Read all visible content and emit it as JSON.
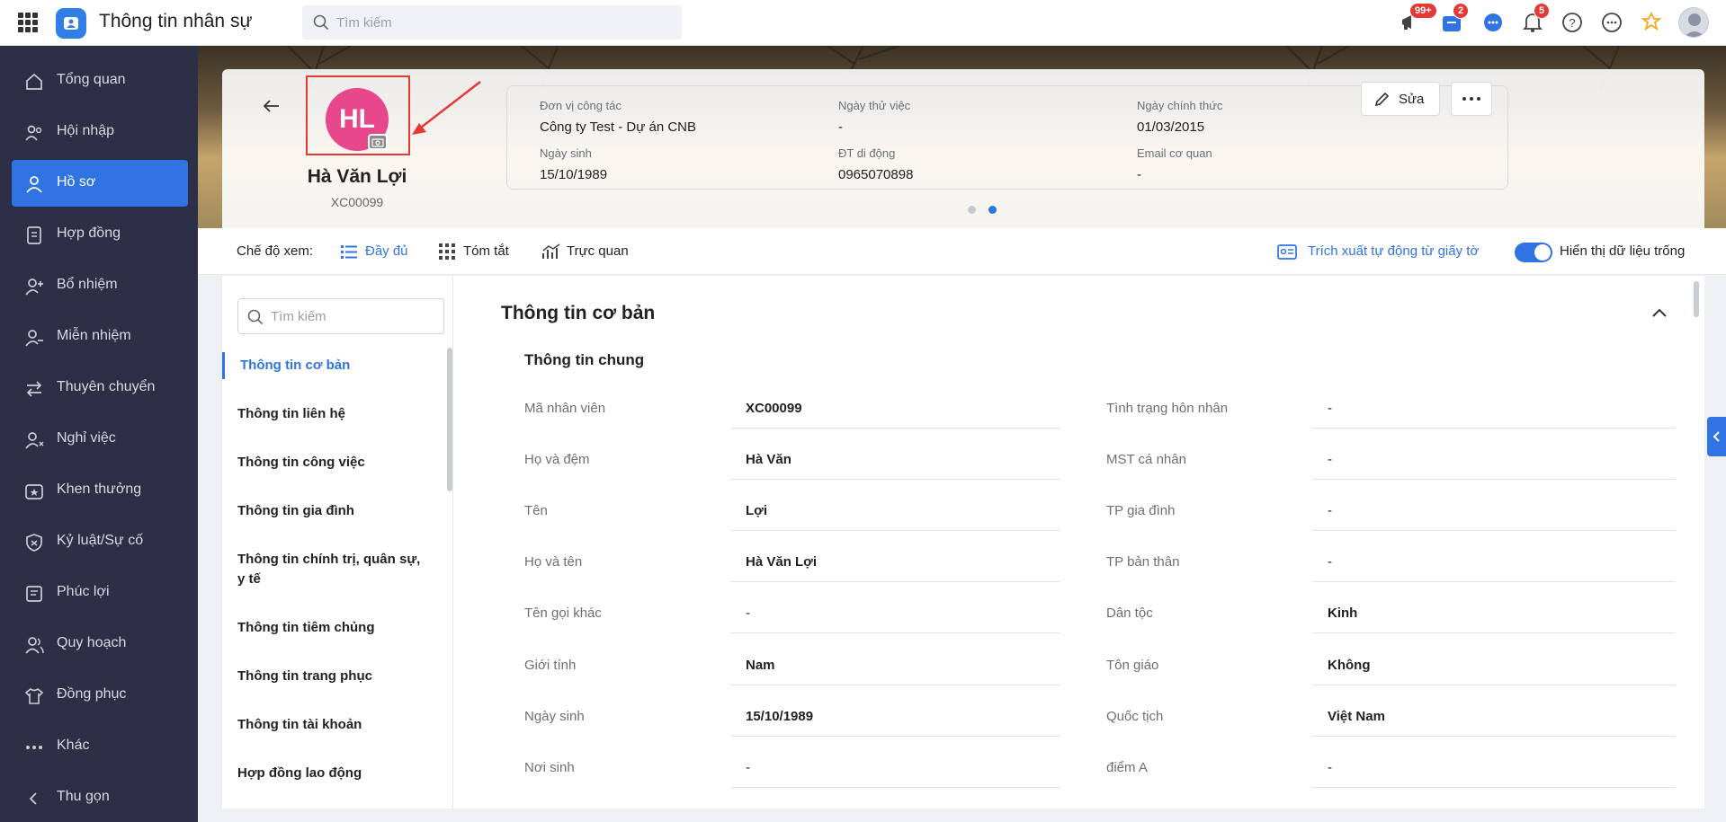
{
  "app": {
    "title": "Thông tin nhân sự",
    "search_placeholder": "Tìm kiếm"
  },
  "header_badges": {
    "announce": "99+",
    "store": "2",
    "bell": "5"
  },
  "sidebar": {
    "items": [
      {
        "label": "Tổng quan",
        "icon": "home-icon"
      },
      {
        "label": "Hội nhập",
        "icon": "users-icon"
      },
      {
        "label": "Hồ sơ",
        "icon": "user-icon",
        "active": true
      },
      {
        "label": "Hợp đồng",
        "icon": "document-icon"
      },
      {
        "label": "Bổ nhiệm",
        "icon": "user-plus-icon"
      },
      {
        "label": "Miễn nhiệm",
        "icon": "user-minus-icon"
      },
      {
        "label": "Thuyên chuyển",
        "icon": "swap-icon"
      },
      {
        "label": "Nghỉ việc",
        "icon": "user-leave-icon"
      },
      {
        "label": "Khen thưởng",
        "icon": "award-icon"
      },
      {
        "label": "Kỷ luật/Sự cố",
        "icon": "shield-icon"
      },
      {
        "label": "Phúc lợi",
        "icon": "gift-icon"
      },
      {
        "label": "Quy hoạch",
        "icon": "people-icon"
      },
      {
        "label": "Đồng phục",
        "icon": "shirt-icon"
      },
      {
        "label": "Khác",
        "icon": "more-icon"
      }
    ],
    "collapse_label": "Thu gọn"
  },
  "profile": {
    "initials": "HL",
    "name": "Hà Văn Lợi",
    "code": "XC00099",
    "info": [
      {
        "key": "Đơn vị công tác",
        "value": "Công ty Test - Dự án CNB"
      },
      {
        "key": "Ngày thử việc",
        "value": "-"
      },
      {
        "key": "Ngày chính thức",
        "value": "01/03/2015"
      },
      {
        "key": "Ngày sinh",
        "value": "15/10/1989"
      },
      {
        "key": "ĐT di động",
        "value": "0965070898"
      },
      {
        "key": "Email cơ quan",
        "value": "-"
      }
    ],
    "edit_label": "Sửa"
  },
  "toolbar": {
    "view_mode_label": "Chế độ xem:",
    "full": "Đầy đủ",
    "summary": "Tóm tắt",
    "visual": "Trực quan",
    "extract": "Trích xuất tự động từ giấy tờ",
    "show_empty": "Hiển thị dữ liệu trống"
  },
  "nav": {
    "search_placeholder": "Tìm kiếm",
    "items": [
      "Thông tin cơ bản",
      "Thông tin liên hệ",
      "Thông tin công việc",
      "Thông tin gia đình",
      "Thông tin chính trị, quân sự, y tế",
      "Thông tin tiêm chủng",
      "Thông tin trang phục",
      "Thông tin tài khoản",
      "Hợp đồng lao động"
    ]
  },
  "detail": {
    "section_title": "Thông tin cơ bản",
    "subsection_title": "Thông tin chung",
    "left_fields": [
      {
        "label": "Mã nhân viên",
        "value": "XC00099"
      },
      {
        "label": "Họ và đệm",
        "value": "Hà Văn"
      },
      {
        "label": "Tên",
        "value": "Lợi"
      },
      {
        "label": "Họ và tên",
        "value": "Hà Văn Lợi"
      },
      {
        "label": "Tên gọi khác",
        "value": "-"
      },
      {
        "label": "Giới tính",
        "value": "Nam"
      },
      {
        "label": "Ngày sinh",
        "value": "15/10/1989"
      },
      {
        "label": "Nơi sinh",
        "value": "-"
      }
    ],
    "right_fields": [
      {
        "label": "Tình trạng hôn nhân",
        "value": "-"
      },
      {
        "label": "MST cá nhân",
        "value": "-"
      },
      {
        "label": "TP gia đình",
        "value": "-"
      },
      {
        "label": "TP bản thân",
        "value": "-"
      },
      {
        "label": "Dân tộc",
        "value": "Kinh"
      },
      {
        "label": "Tôn giáo",
        "value": "Không"
      },
      {
        "label": "Quốc tịch",
        "value": "Việt Nam"
      },
      {
        "label": "điểm A",
        "value": "-"
      }
    ]
  }
}
